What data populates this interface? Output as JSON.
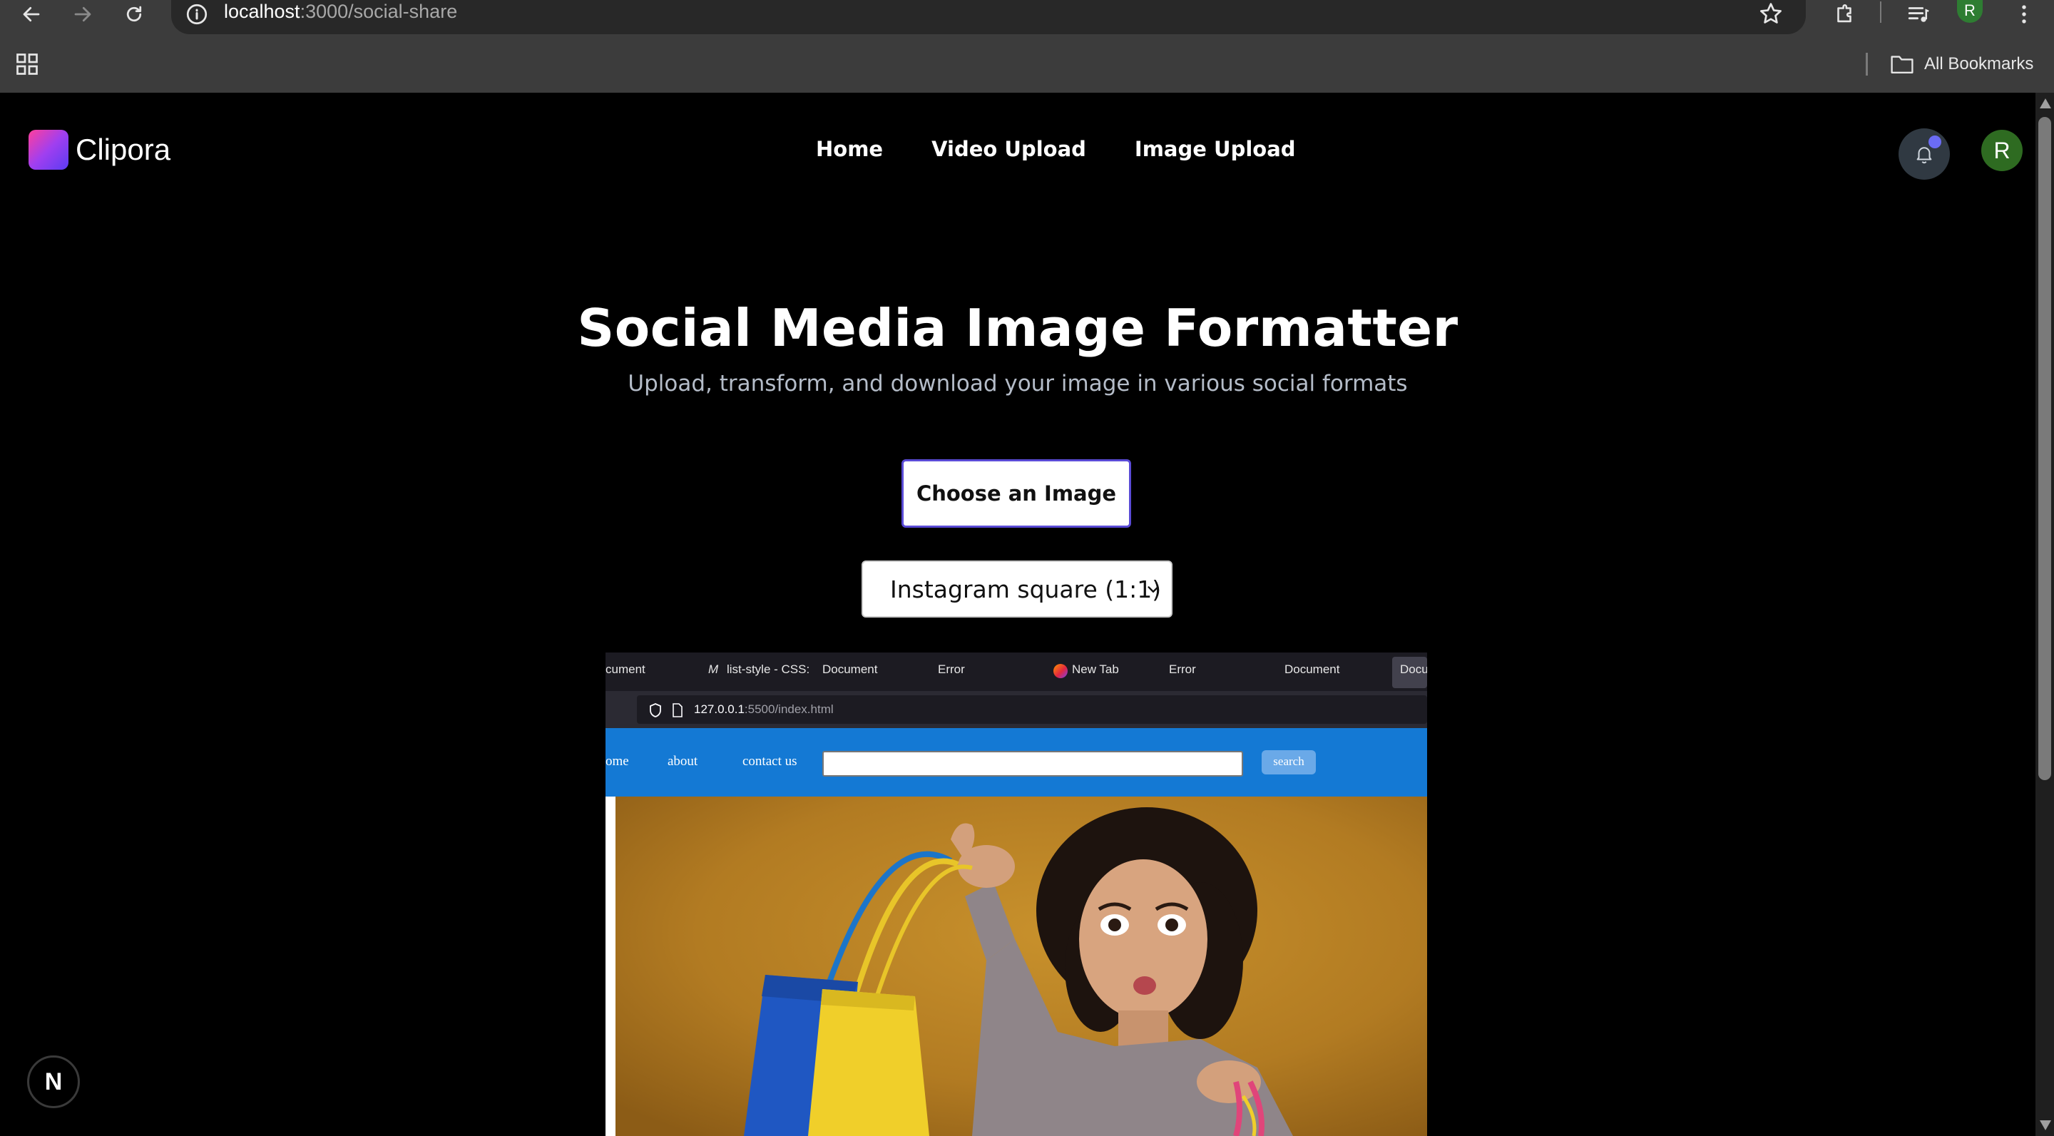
{
  "browser": {
    "url_host": "localhost",
    "url_path": ":3000/social-share",
    "profile_initial": "R",
    "all_bookmarks_label": "All Bookmarks",
    "icons": [
      "back-arrow-icon",
      "forward-arrow-icon",
      "reload-icon",
      "site-info-icon",
      "star-icon",
      "extensions-icon",
      "media-queue-icon",
      "more-vertical-icon",
      "apps-grid-icon",
      "folder-icon"
    ]
  },
  "app": {
    "logo_text": "Clipora",
    "nav_links": [
      "Home",
      "Video Upload",
      "Image Upload"
    ],
    "avatar_initial": "R",
    "colors": {
      "background": "#000000",
      "accent": "#5a4bd6",
      "logo_gradient": [
        "#ff3f9c",
        "#5b3cf2"
      ],
      "notification_dot": "#6b6cf5",
      "avatar": "#2e6b21"
    }
  },
  "main": {
    "title": "Social Media Image Formatter",
    "subtitle": "Upload, transform, and download your image in various social formats",
    "choose_button": "Choose an Image",
    "format_select": {
      "selected": "Instagram square (1:1)"
    }
  },
  "preview": {
    "tabs": [
      "cument",
      "list-style - CSS:",
      "Document",
      "Error",
      "New Tab",
      "Error",
      "Document",
      "Docu"
    ],
    "url_host": "127.0.0.1",
    "url_rest": ":5500/index.html",
    "nav_links": [
      "ome",
      "about",
      "contact us"
    ],
    "search_button": "search"
  },
  "dev_badge": "N"
}
